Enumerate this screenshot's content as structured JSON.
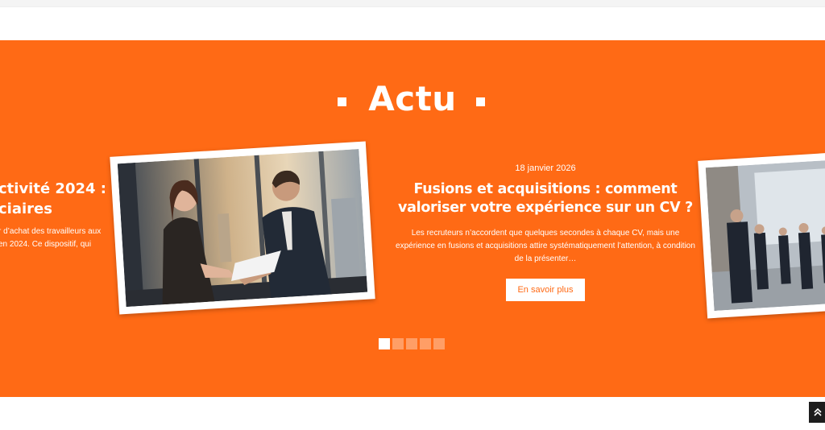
{
  "section": {
    "title": "Actu"
  },
  "prev_article": {
    "title_line1": "ctivité 2024 :",
    "title_line2": "ciaires",
    "excerpt_line1": "r d’achat des travailleurs aux",
    "excerpt_line2": "en 2024. Ce dispositif, qui"
  },
  "article": {
    "date": "18 janvier 2026",
    "title": "Fusions et acquisitions : comment valoriser votre expérience sur un CV ?",
    "excerpt": "Les recruteurs n’accordent que quelques secondes à chaque CV, mais une expérience en fusions et acquisitions attire systématiquement l’attention, à condition de la présenter…",
    "button_label": "En savoir plus",
    "image_icon": "business-handshake-photo"
  },
  "next_article": {
    "image_icon": "office-people-walking-photo"
  },
  "pagination": {
    "count": 5,
    "active_index": 0
  },
  "scroll_top": {
    "icon": "double-chevron-up-icon"
  },
  "colors": {
    "accent": "#ff6a15",
    "white": "#ffffff",
    "dark": "#1d1d1d"
  }
}
